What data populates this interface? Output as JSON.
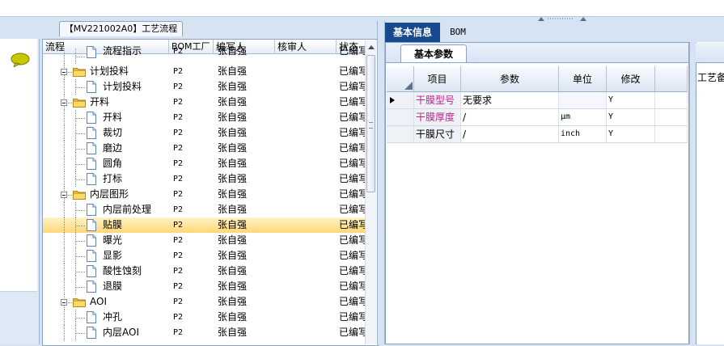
{
  "flow_panel": {
    "title": "【MV221002A0】工艺流程",
    "columns": [
      "流程",
      "BOM工厂",
      "编写人",
      "核审人",
      "状态"
    ],
    "rows": [
      {
        "label": "流程指示",
        "level": 2,
        "type": "doc",
        "factory": "P2",
        "writer": "张自强",
        "reviewer": "",
        "status": "已编写",
        "partial": true
      },
      {
        "label": "计划投料",
        "level": 1,
        "type": "folder",
        "factory": "P2",
        "writer": "张自强",
        "reviewer": "",
        "status": "已编写"
      },
      {
        "label": "计划投料",
        "level": 2,
        "type": "doc",
        "factory": "P2",
        "writer": "张自强",
        "reviewer": "",
        "status": "已编写"
      },
      {
        "label": "开料",
        "level": 1,
        "type": "folder",
        "factory": "P2",
        "writer": "张自强",
        "reviewer": "",
        "status": "已编写"
      },
      {
        "label": "开料",
        "level": 2,
        "type": "doc",
        "factory": "P2",
        "writer": "张自强",
        "reviewer": "",
        "status": "已编写"
      },
      {
        "label": "裁切",
        "level": 2,
        "type": "doc",
        "factory": "P2",
        "writer": "张自强",
        "reviewer": "",
        "status": "已编写"
      },
      {
        "label": "磨边",
        "level": 2,
        "type": "doc",
        "factory": "P2",
        "writer": "张自强",
        "reviewer": "",
        "status": "已编写"
      },
      {
        "label": "圆角",
        "level": 2,
        "type": "doc",
        "factory": "P2",
        "writer": "张自强",
        "reviewer": "",
        "status": "已编写"
      },
      {
        "label": "打标",
        "level": 2,
        "type": "doc",
        "factory": "P2",
        "writer": "张自强",
        "reviewer": "",
        "status": "已编写"
      },
      {
        "label": "内层图形",
        "level": 1,
        "type": "folder",
        "factory": "P2",
        "writer": "张自强",
        "reviewer": "",
        "status": "已编写"
      },
      {
        "label": "内层前处理",
        "level": 2,
        "type": "doc",
        "factory": "P2",
        "writer": "张自强",
        "reviewer": "",
        "status": "已编写"
      },
      {
        "label": "贴膜",
        "level": 2,
        "type": "doc",
        "factory": "P2",
        "writer": "张自强",
        "reviewer": "",
        "status": "已编写",
        "selected": true
      },
      {
        "label": "曝光",
        "level": 2,
        "type": "doc",
        "factory": "P2",
        "writer": "张自强",
        "reviewer": "",
        "status": "已编写"
      },
      {
        "label": "显影",
        "level": 2,
        "type": "doc",
        "factory": "P2",
        "writer": "张自强",
        "reviewer": "",
        "status": "已编写"
      },
      {
        "label": "酸性蚀刻",
        "level": 2,
        "type": "doc",
        "factory": "P2",
        "writer": "张自强",
        "reviewer": "",
        "status": "已编写"
      },
      {
        "label": "退膜",
        "level": 2,
        "type": "doc",
        "factory": "P2",
        "writer": "张自强",
        "reviewer": "",
        "status": "已编写"
      },
      {
        "label": "AOI",
        "level": 1,
        "type": "folder",
        "factory": "P2",
        "writer": "张自强",
        "reviewer": "",
        "status": "已编写"
      },
      {
        "label": "冲孔",
        "level": 2,
        "type": "doc",
        "factory": "P2",
        "writer": "张自强",
        "reviewer": "",
        "status": "已编写"
      },
      {
        "label": "内层AOI",
        "level": 2,
        "type": "doc",
        "factory": "P2",
        "writer": "张自强",
        "reviewer": "",
        "status": "已编写"
      }
    ]
  },
  "right_panel": {
    "tabs": [
      "基本信息",
      "BOM"
    ],
    "active_tab": "基本信息",
    "sub_tab": "基本参数",
    "param_columns": [
      "项目",
      "参数",
      "单位",
      "修改"
    ],
    "param_rows": [
      {
        "item": "干膜型号",
        "value": "无要求",
        "unit": "",
        "modify": "Y",
        "current": true,
        "highlight": true
      },
      {
        "item": "干膜厚度",
        "value": "/",
        "unit": "μm",
        "modify": "Y",
        "highlight": true
      },
      {
        "item": "干膜尺寸",
        "value": "/",
        "unit": "inch",
        "modify": "Y",
        "highlight": false
      }
    ]
  },
  "far_right_panel": {
    "label": "工艺备"
  },
  "colors": {
    "active_tab_bg": "#16498e",
    "selected_row": "#ffd777",
    "highlight_text": "#c0208f",
    "panel_border": "#8ba3c3"
  },
  "icons": [
    "chat-bubble-icon",
    "folder-icon",
    "document-icon",
    "expand-collapse-icon",
    "row-pointer-icon",
    "scroll-up-icon"
  ]
}
